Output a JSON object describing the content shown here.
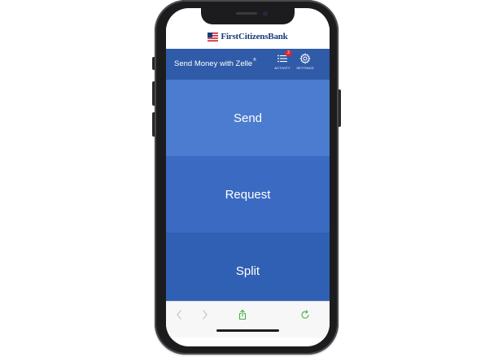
{
  "bank": {
    "name": "FirstCitizensBank"
  },
  "app_bar": {
    "title": "Send Money with Zelle",
    "title_mark": "®",
    "activity_label": "ACTIVITY",
    "activity_badge": "2",
    "settings_label": "SETTINGS"
  },
  "actions": {
    "send": "Send",
    "request": "Request",
    "split": "Split"
  },
  "toolbar": {
    "icons": [
      "back-chevron-icon",
      "forward-chevron-icon",
      "share-icon",
      "reload-icon"
    ]
  },
  "colors": {
    "app_bar": "#2f5ba8",
    "send_tile": "#4b7ccf",
    "request_tile": "#3b6ac2",
    "split_tile": "#3060b4",
    "badge": "#d9292f",
    "toolbar_accent": "#4caf50"
  }
}
